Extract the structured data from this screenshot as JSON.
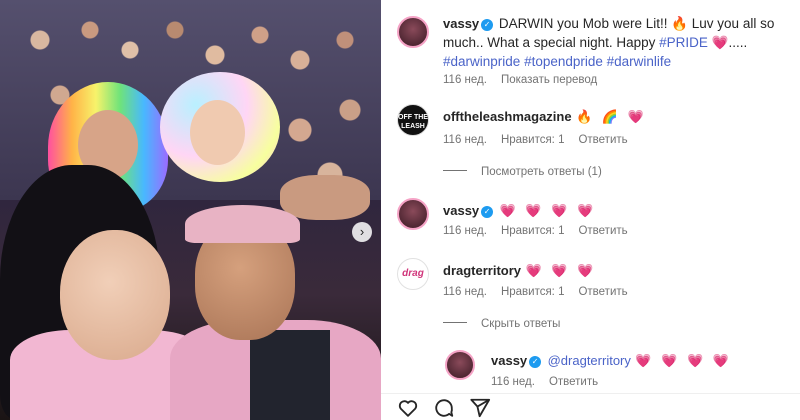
{
  "post": {
    "author": "vassy",
    "caption_main": "DARWIN you Mob were Lit!! 🔥 Luv you all so much.. What a special night. Happy ",
    "caption_tag_pride": "#PRIDE",
    "caption_after_pride": " 💗..... ",
    "caption_tag_darwinpride": "#darwinpride",
    "caption_tag_topendpride": "#topendpride",
    "caption_tag_darwinlife": "#darwinlife",
    "time": "116 нед.",
    "translate_label": "Показать перевод",
    "carousel_symbol": "›"
  },
  "comments": [
    {
      "user": "offtheleashmagazine",
      "text": "🔥 🌈 💗",
      "time": "116 нед.",
      "likes": "Нравится: 1",
      "reply_label": "Ответить",
      "avatar_text": "OFF THE LEASH",
      "view_replies": "Посмотреть ответы (1)"
    },
    {
      "user": "vassy",
      "text": "💗 💗 💗 💗",
      "time": "116 нед.",
      "likes": "Нравится: 1",
      "reply_label": "Ответить"
    },
    {
      "user": "dragterritory",
      "text": "💗 💗 💗",
      "time": "116 нед.",
      "likes": "Нравится: 1",
      "reply_label": "Ответить",
      "avatar_text": "drag",
      "hide_replies": "Скрыть ответы"
    }
  ],
  "reply": {
    "user": "vassy",
    "mention": "@dragterritory",
    "text": "💗 💗 💗 💗",
    "time": "116 нед.",
    "reply_label": "Ответить"
  },
  "colors": {
    "accent_link": "#4a63c8",
    "verified": "#1d9bf0",
    "heart": "#e8328a"
  },
  "icons": [
    "heart-outline-icon",
    "comment-icon",
    "share-icon",
    "verified-icon",
    "chevron-right-icon"
  ]
}
